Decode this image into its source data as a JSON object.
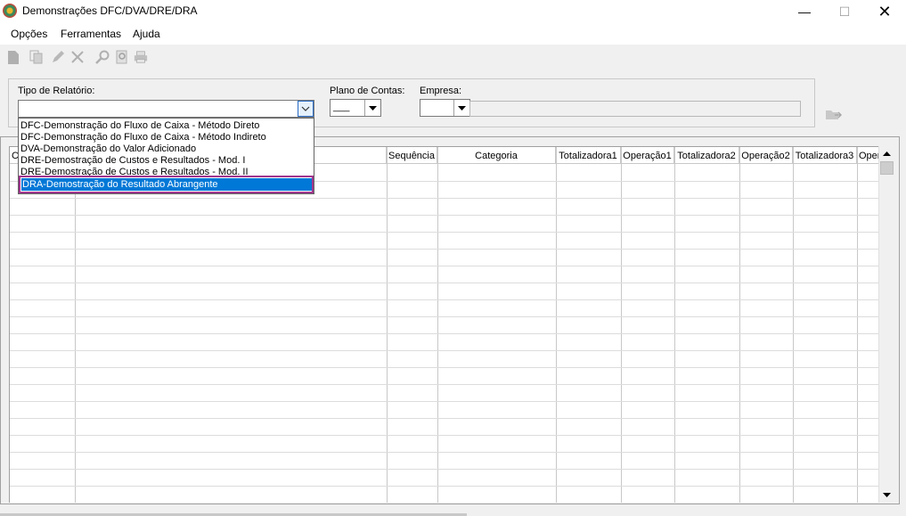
{
  "window": {
    "title": "Demonstrações DFC/DVA/DRE/DRA",
    "minimize": "—",
    "maximize": "☐",
    "close": "✕"
  },
  "menu": {
    "items": [
      "Opções",
      "Ferramentas",
      "Ajuda"
    ]
  },
  "toolbar": {
    "icons": [
      "new-document-icon",
      "copy-icon",
      "edit-icon",
      "delete-icon",
      "search-icon",
      "preview-icon",
      "print-icon"
    ]
  },
  "filters": {
    "report_type_label": "Tipo de Relatório:",
    "report_type_value": "",
    "chart_of_accounts_label": "Plano de Contas:",
    "chart_of_accounts_value": "___",
    "company_label": "Empresa:",
    "company_value": "",
    "company_name": ""
  },
  "dropdown": {
    "options": [
      "DFC-Demonstração do Fluxo de Caixa - Método Direto",
      "DFC-Demonstração do Fluxo de Caixa - Método Indireto",
      "DVA-Demonstração do Valor Adicionado",
      "DRE-Demostração de Custos e Resultados - Mod. I",
      "DRE-Demostração de Custos e Resultados - Mod. II"
    ],
    "selected": "DRA-Demostração do Resultado Abrangente"
  },
  "grid": {
    "first_header_fragment": "C",
    "columns": [
      "Sequência",
      "Categoria",
      "Totalizadora1",
      "Operação1",
      "Totalizadora2",
      "Operação2",
      "Totalizadora3",
      "Oper"
    ]
  }
}
